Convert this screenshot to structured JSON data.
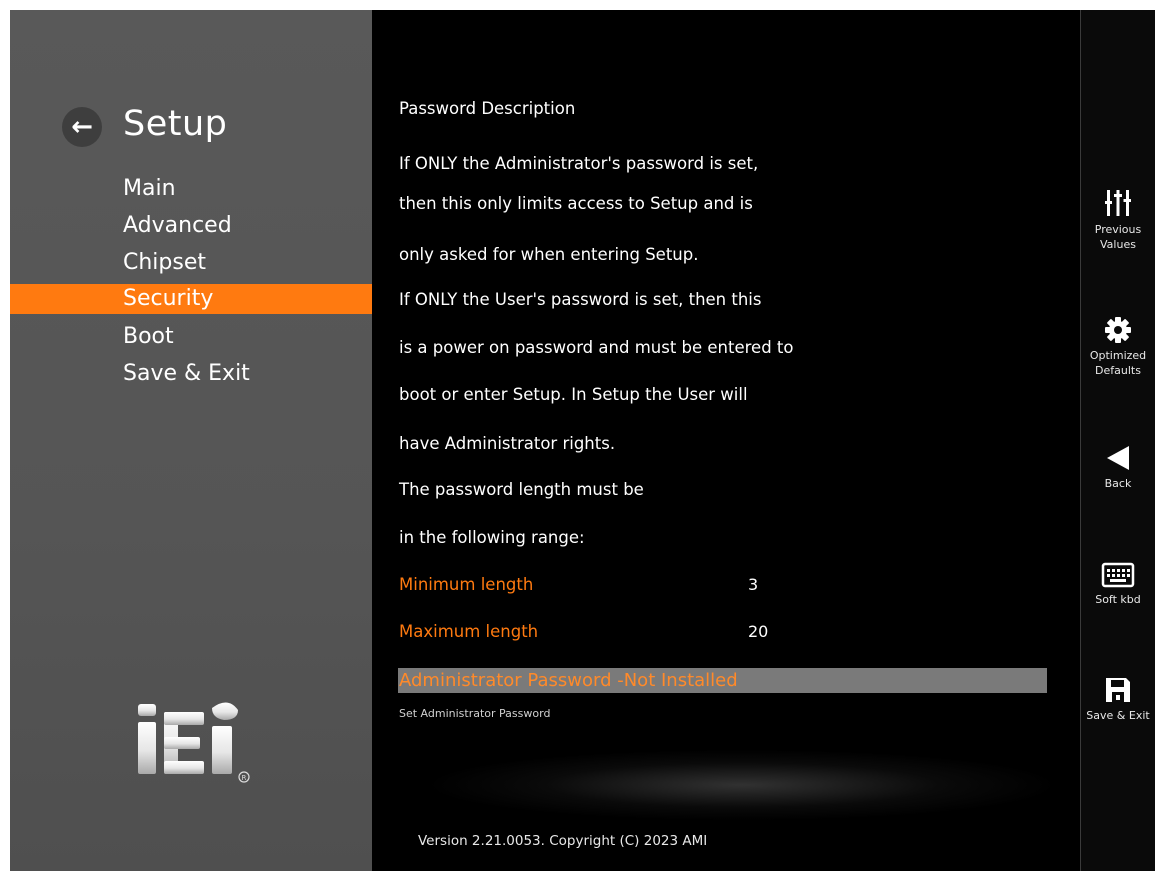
{
  "sidebar": {
    "title": "Setup",
    "items": [
      {
        "label": "Main"
      },
      {
        "label": "Advanced"
      },
      {
        "label": "Chipset"
      },
      {
        "label": "Security",
        "active": true
      },
      {
        "label": "Boot"
      },
      {
        "label": "Save & Exit"
      }
    ],
    "logo_text": "iEi"
  },
  "content": {
    "description_lines": [
      "Password Description",
      "If ONLY the Administrator's password is set,",
      "then this only limits access to Setup and is",
      "only asked for when entering Setup.",
      "If ONLY the User's password is set, then this",
      "is a power on password and must be entered to",
      "boot or enter Setup. In Setup the User will",
      "have Administrator rights.",
      "The password length must be",
      "in the following range:"
    ],
    "min_label": "Minimum length",
    "min_value": "3",
    "max_label": "Maximum length",
    "max_value": "20",
    "admin_password": "Administrator Password -Not Installed",
    "help_text": "Set Administrator Password",
    "version": "Version 2.21.0053. Copyright (C) 2023 AMI"
  },
  "actions": [
    {
      "label_line1": "Previous",
      "label_line2": "Values",
      "icon": "sliders-icon"
    },
    {
      "label_line1": "Optimized",
      "label_line2": "Defaults",
      "icon": "gear-icon"
    },
    {
      "label_line1": "Back",
      "label_line2": "",
      "icon": "triangle-left-icon"
    },
    {
      "label_line1": "Soft kbd",
      "label_line2": "",
      "icon": "keyboard-icon"
    },
    {
      "label_line1": "Save & Exit",
      "label_line2": "",
      "icon": "floppy-icon"
    }
  ],
  "colors": {
    "accent": "#ff7a10",
    "sidebar_bg": "#555555",
    "main_bg": "#000000",
    "highlight_row": "#7a7a7a"
  }
}
